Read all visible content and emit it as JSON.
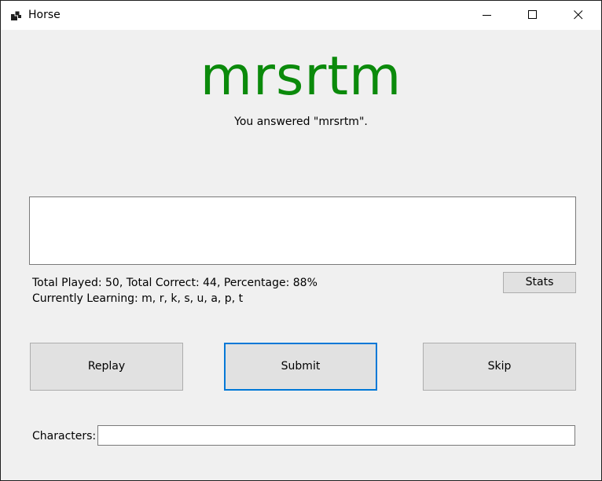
{
  "window": {
    "title": "Horse"
  },
  "main": {
    "answer_word": "mrsrtm",
    "answer_color": "#0b8a0b",
    "feedback": "You answered \"mrsrtm\".",
    "output_text": ""
  },
  "stats": {
    "summary": "Total Played: 50, Total Correct: 44, Percentage: 88%",
    "learning": "Currently Learning: m, r, k, s, u, a, p, t",
    "button_label": "Stats"
  },
  "actions": {
    "replay_label": "Replay",
    "submit_label": "Submit",
    "skip_label": "Skip"
  },
  "characters": {
    "label": "Characters:",
    "value": ""
  },
  "icons": {
    "app": "app-windows-icon",
    "minimize": "minimize-icon",
    "maximize": "maximize-icon",
    "close": "close-icon"
  }
}
